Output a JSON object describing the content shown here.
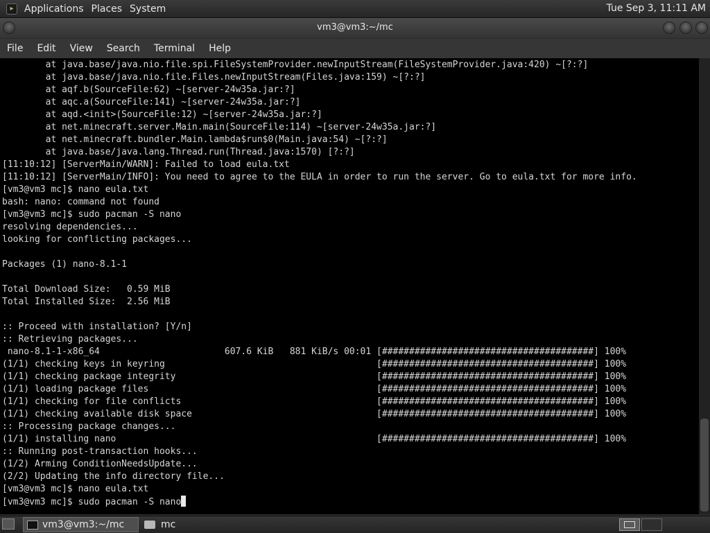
{
  "top_panel": {
    "menus": [
      "Applications",
      "Places",
      "System"
    ],
    "clock": "Tue Sep  3, 11:11 AM"
  },
  "window": {
    "title": "vm3@vm3:~/mc"
  },
  "menubar": {
    "items": [
      "File",
      "Edit",
      "View",
      "Search",
      "Terminal",
      "Help"
    ]
  },
  "terminal": {
    "lines": [
      "        at java.base/java.nio.file.spi.FileSystemProvider.newInputStream(FileSystemProvider.java:420) ~[?:?]",
      "        at java.base/java.nio.file.Files.newInputStream(Files.java:159) ~[?:?]",
      "        at aqf.b(SourceFile:62) ~[server-24w35a.jar:?]",
      "        at aqc.a(SourceFile:141) ~[server-24w35a.jar:?]",
      "        at aqd.<init>(SourceFile:12) ~[server-24w35a.jar:?]",
      "        at net.minecraft.server.Main.main(SourceFile:114) ~[server-24w35a.jar:?]",
      "        at net.minecraft.bundler.Main.lambda$run$0(Main.java:54) ~[?:?]",
      "        at java.base/java.lang.Thread.run(Thread.java:1570) [?:?]",
      "[11:10:12] [ServerMain/WARN]: Failed to load eula.txt",
      "[11:10:12] [ServerMain/INFO]: You need to agree to the EULA in order to run the server. Go to eula.txt for more info.",
      "[vm3@vm3 mc]$ nano eula.txt",
      "bash: nano: command not found",
      "[vm3@vm3 mc]$ sudo pacman -S nano",
      "resolving dependencies...",
      "looking for conflicting packages...",
      "",
      "Packages (1) nano-8.1-1",
      "",
      "Total Download Size:   0.59 MiB",
      "Total Installed Size:  2.56 MiB",
      "",
      ":: Proceed with installation? [Y/n]",
      ":: Retrieving packages...",
      " nano-8.1-1-x86_64                       607.6 KiB   881 KiB/s 00:01 [#######################################] 100%",
      "(1/1) checking keys in keyring                                       [#######################################] 100%",
      "(1/1) checking package integrity                                     [#######################################] 100%",
      "(1/1) loading package files                                          [#######################################] 100%",
      "(1/1) checking for file conflicts                                    [#######################################] 100%",
      "(1/1) checking available disk space                                  [#######################################] 100%",
      ":: Processing package changes...",
      "(1/1) installing nano                                                [#######################################] 100%",
      ":: Running post-transaction hooks...",
      "(1/2) Arming ConditionNeedsUpdate...",
      "(2/2) Updating the info directory file...",
      "[vm3@vm3 mc]$ nano eula.txt",
      "[vm3@vm3 mc]$ sudo pacman -S nano"
    ]
  },
  "taskbar": {
    "tasks": [
      "vm3@vm3:~/mc",
      "mc"
    ]
  },
  "icons": {
    "applications": "applications-icon",
    "show_desktop": "show-desktop-icon",
    "terminal": "terminal-icon",
    "folder": "folder-icon"
  }
}
